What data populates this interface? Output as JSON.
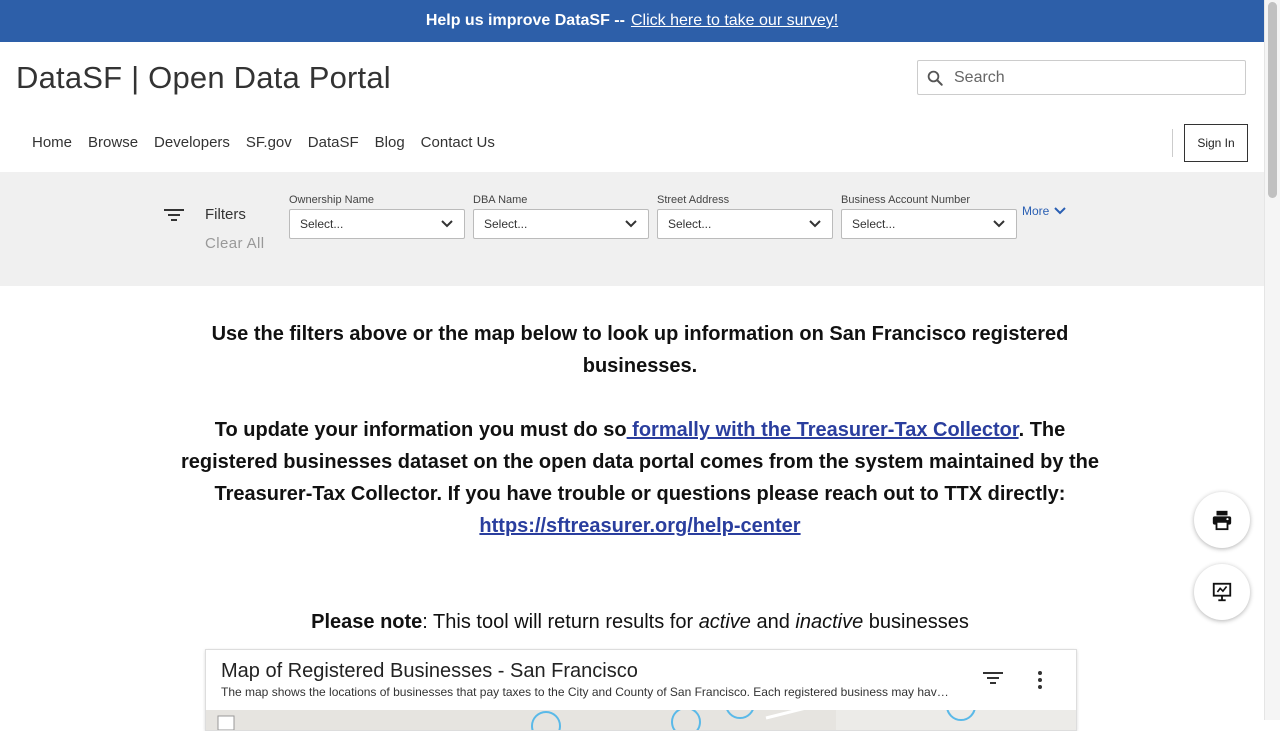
{
  "banner": {
    "text": "Help us improve DataSF --",
    "link": "Click here to take our survey!"
  },
  "header": {
    "title": "DataSF | Open Data Portal",
    "search_placeholder": "Search",
    "nav": [
      "Home",
      "Browse",
      "Developers",
      "SF.gov",
      "DataSF",
      "Blog",
      "Contact Us"
    ],
    "signin": "Sign In"
  },
  "filters": {
    "label": "Filters",
    "clear": "Clear All",
    "groups": [
      {
        "label": "Ownership Name",
        "value": "Select..."
      },
      {
        "label": "DBA Name",
        "value": "Select..."
      },
      {
        "label": "Street Address",
        "value": "Select..."
      },
      {
        "label": "Business Account Number",
        "value": "Select..."
      }
    ],
    "more": "More"
  },
  "content": {
    "intro": "Use the filters above or the map below to look up information on San Francisco registered businesses.",
    "update_pre": "To update your information you must do so",
    "update_link": " formally with the Treasurer-Tax Collector",
    "update_post": ". The registered businesses dataset on the open data portal comes from the system maintained by the Treasurer-Tax Collector. If you have trouble or questions please reach out to TTX directly: ",
    "help_link": "https://sftreasurer.org/help-center",
    "note_bold": "Please note",
    "note_1": ": This tool will return results for ",
    "note_active": "active",
    "note_and": " and ",
    "note_inactive": "inactive",
    "note_end": " businesses"
  },
  "card": {
    "title": "Map of Registered Businesses - San Francisco",
    "description": "The map shows the locations of businesses that pay taxes to the City and County of San Francisco. Each registered business may have multiple locations and each location is a single row."
  },
  "icons": [
    "search-icon",
    "filter-icon",
    "chevron-down-icon",
    "print-icon",
    "presentation-icon",
    "more-vert-icon"
  ],
  "colors": {
    "banner": "#2d5fa9",
    "link": "#2a3e9e",
    "filterbar": "#f0f0f0"
  }
}
